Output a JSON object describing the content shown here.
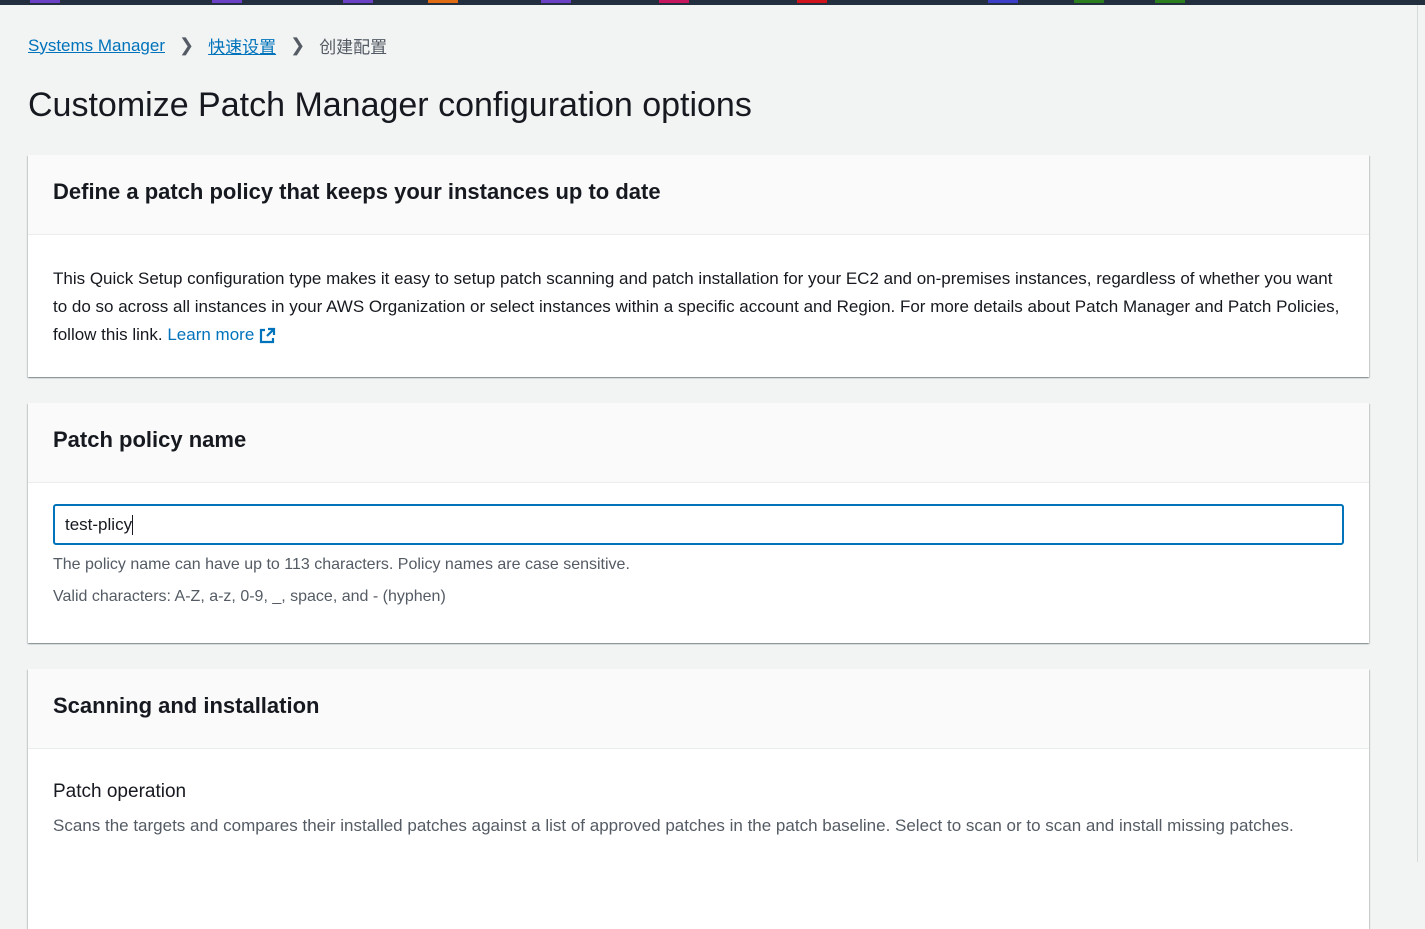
{
  "topbar": {
    "segment_colors": [
      "#6b40c4",
      "#6b40c4",
      "#6b40c4",
      "#e06b10",
      "#6b40c4",
      "#c7165e",
      "#d0121b",
      "#3c3ec8",
      "#2b7d1d",
      "#2b7d1d"
    ]
  },
  "breadcrumb": {
    "items": [
      "Systems Manager",
      "快速设置"
    ],
    "current": "创建配置"
  },
  "page": {
    "title": "Customize Patch Manager configuration options"
  },
  "define": {
    "title": "Define a patch policy that keeps your instances up to date",
    "text": "This Quick Setup configuration type makes it easy to setup patch scanning and patch installation for your EC2 and on-premises instances, regardless of whether you want to do so across all instances in your AWS Organization or select instances within a specific account and Region. For more details about Patch Manager and Patch Policies, follow this link.",
    "link": "Learn more"
  },
  "name": {
    "title": "Patch policy name",
    "value": "test-plicy",
    "hint1": "The policy name can have up to 113 characters. Policy names are case sensitive.",
    "hint2": "Valid characters: A-Z, a-z, 0-9, _, space, and - (hyphen)"
  },
  "scan": {
    "title": "Scanning and installation",
    "label": "Patch operation",
    "desc": "Scans the targets and compares their installed patches against a list of approved patches in the patch baseline. Select to scan or to scan and install missing patches."
  }
}
